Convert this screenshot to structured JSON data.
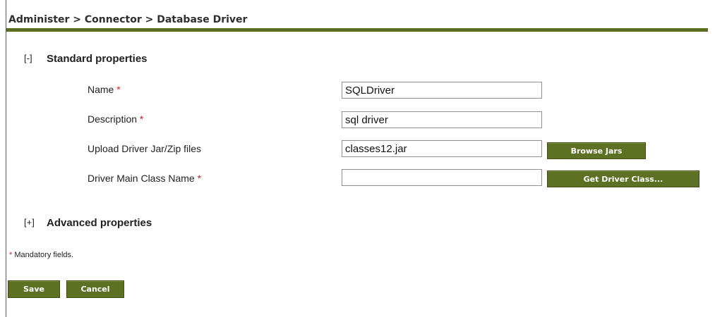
{
  "breadcrumb": "Administer > Connector > Database Driver",
  "standard_section": {
    "toggle": "[-]",
    "title": "Standard properties"
  },
  "fields": {
    "name": {
      "label": "Name",
      "required_mark": "*",
      "value": "SQLDriver"
    },
    "description": {
      "label": "Description",
      "required_mark": "*",
      "value": "sql driver"
    },
    "upload": {
      "label": "Upload Driver Jar/Zip files",
      "value": "classes12.jar",
      "button": "Browse Jars"
    },
    "main_class": {
      "label": "Driver Main Class Name",
      "required_mark": "*",
      "value": "",
      "button": "Get Driver Class..."
    }
  },
  "advanced_section": {
    "toggle": "[+]",
    "title": "Advanced properties"
  },
  "mandatory_note": {
    "mark": "*",
    "text": "Mandatory fields."
  },
  "actions": {
    "save": "Save",
    "cancel": "Cancel"
  },
  "colors": {
    "accent": "#5b6e1e",
    "required": "#cc1f1f"
  }
}
